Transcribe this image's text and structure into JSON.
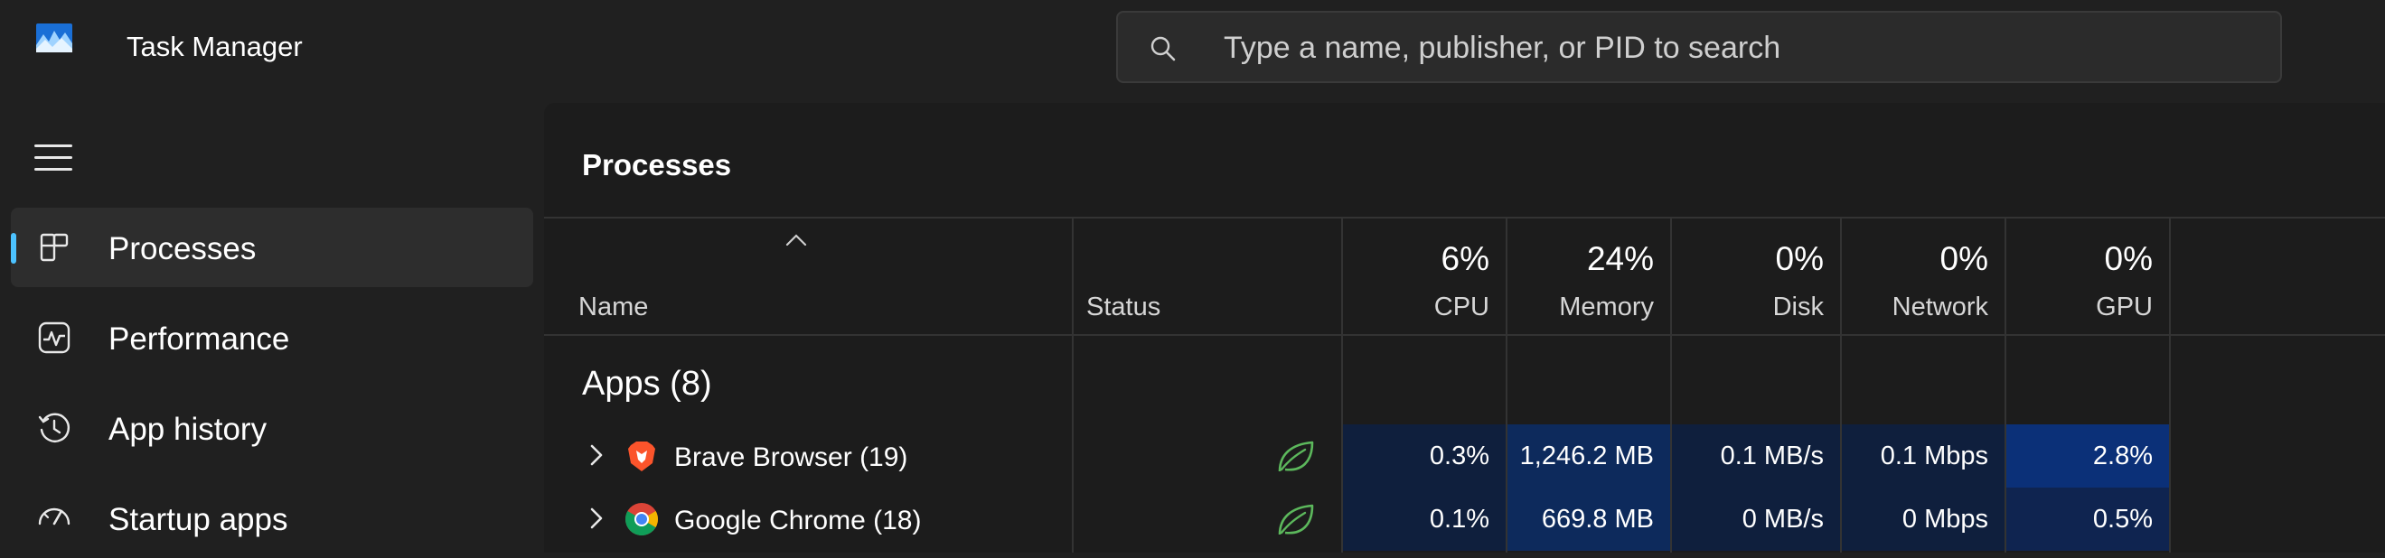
{
  "window": {
    "title": "Task Manager"
  },
  "search": {
    "placeholder": "Type a name, publisher, or PID to search"
  },
  "sidebar": {
    "items": [
      {
        "label": "Processes",
        "icon": "processes-icon",
        "active": true
      },
      {
        "label": "Performance",
        "icon": "performance-icon",
        "active": false
      },
      {
        "label": "App history",
        "icon": "app-history-icon",
        "active": false
      },
      {
        "label": "Startup apps",
        "icon": "startup-apps-icon",
        "active": false
      }
    ]
  },
  "page": {
    "title": "Processes"
  },
  "columns": {
    "name": {
      "label": "Name"
    },
    "status": {
      "label": "Status"
    },
    "cpu": {
      "label": "CPU",
      "percent": "6%"
    },
    "memory": {
      "label": "Memory",
      "percent": "24%"
    },
    "disk": {
      "label": "Disk",
      "percent": "0%"
    },
    "network": {
      "label": "Network",
      "percent": "0%"
    },
    "gpu": {
      "label": "GPU",
      "percent": "0%"
    }
  },
  "group": {
    "label": "Apps (8)"
  },
  "processes": [
    {
      "name": "Brave Browser (19)",
      "icon": "brave-icon",
      "status_icon": "efficiency-mode-leaf-icon",
      "cpu": "0.3%",
      "memory": "1,246.2 MB",
      "disk": "0.1 MB/s",
      "network": "0.1 Mbps",
      "gpu": "2.8%"
    },
    {
      "name": "Google Chrome (18)",
      "icon": "chrome-icon",
      "status_icon": "efficiency-mode-leaf-icon",
      "cpu": "0.1%",
      "memory": "669.8 MB",
      "disk": "0 MB/s",
      "network": "0 Mbps",
      "gpu": "0.5%"
    }
  ],
  "colors": {
    "background": "#202020",
    "panel": "#1c1c1c",
    "accent": "#4cc2ff",
    "heat_light": "#0f1f3d",
    "heat_medium": "#0d2a5c",
    "heat_strong": "#0b3078",
    "leaf": "#5cb85c"
  }
}
